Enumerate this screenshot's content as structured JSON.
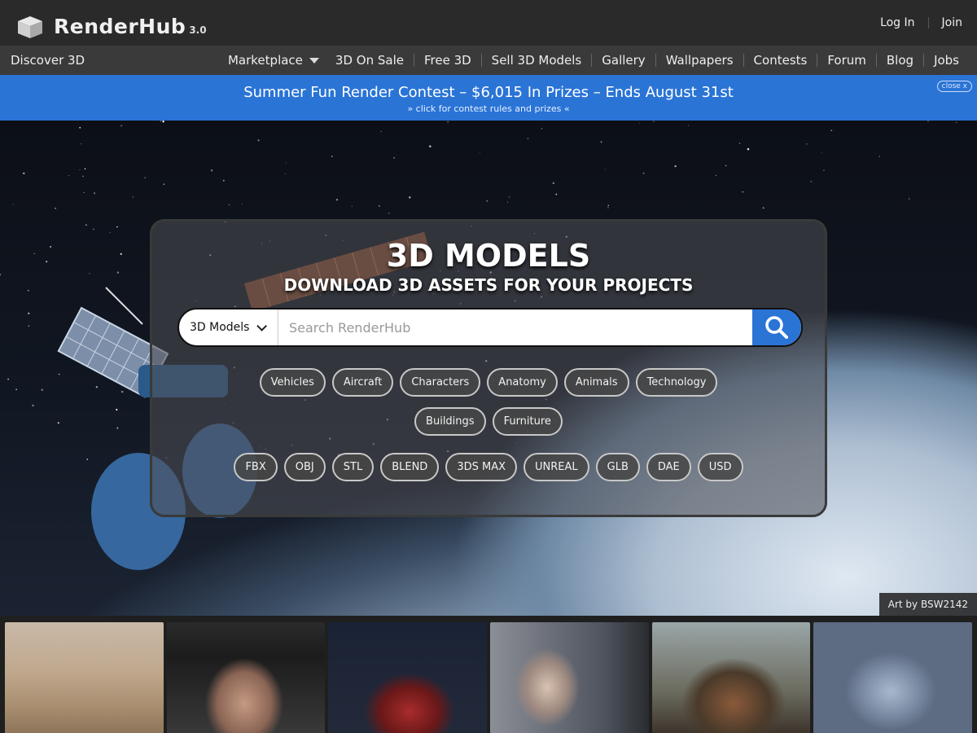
{
  "header": {
    "logo_text": "RenderHub",
    "logo_version": "3.0",
    "login_label": "Log In",
    "join_label": "Join"
  },
  "nav": {
    "discover_label": "Discover 3D",
    "items": [
      "Marketplace",
      "3D On Sale",
      "Free 3D",
      "Sell 3D Models",
      "Gallery",
      "Wallpapers",
      "Contests",
      "Forum",
      "Blog",
      "Jobs"
    ]
  },
  "banner": {
    "title": "Summer Fun Render Contest – $6,015 In Prizes – Ends August 31st",
    "subtitle": "» click for contest rules and prizes «",
    "close_label": "close x"
  },
  "hero": {
    "title": "3D MODELS",
    "subtitle": "DOWNLOAD 3D ASSETS FOR YOUR PROJECTS",
    "search": {
      "category": "3D Models",
      "placeholder": "Search RenderHub"
    },
    "categories": [
      "Vehicles",
      "Aircraft",
      "Characters",
      "Anatomy",
      "Animals",
      "Technology",
      "Buildings",
      "Furniture"
    ],
    "formats": [
      "FBX",
      "OBJ",
      "STL",
      "BLEND",
      "3DS MAX",
      "UNREAL",
      "GLB",
      "DAE",
      "USD"
    ],
    "art_credit": "Art by BSW2142"
  },
  "colors": {
    "accent": "#2a74d6",
    "header_bg": "#2a2a2a",
    "nav_bg": "#3a3a3a"
  }
}
